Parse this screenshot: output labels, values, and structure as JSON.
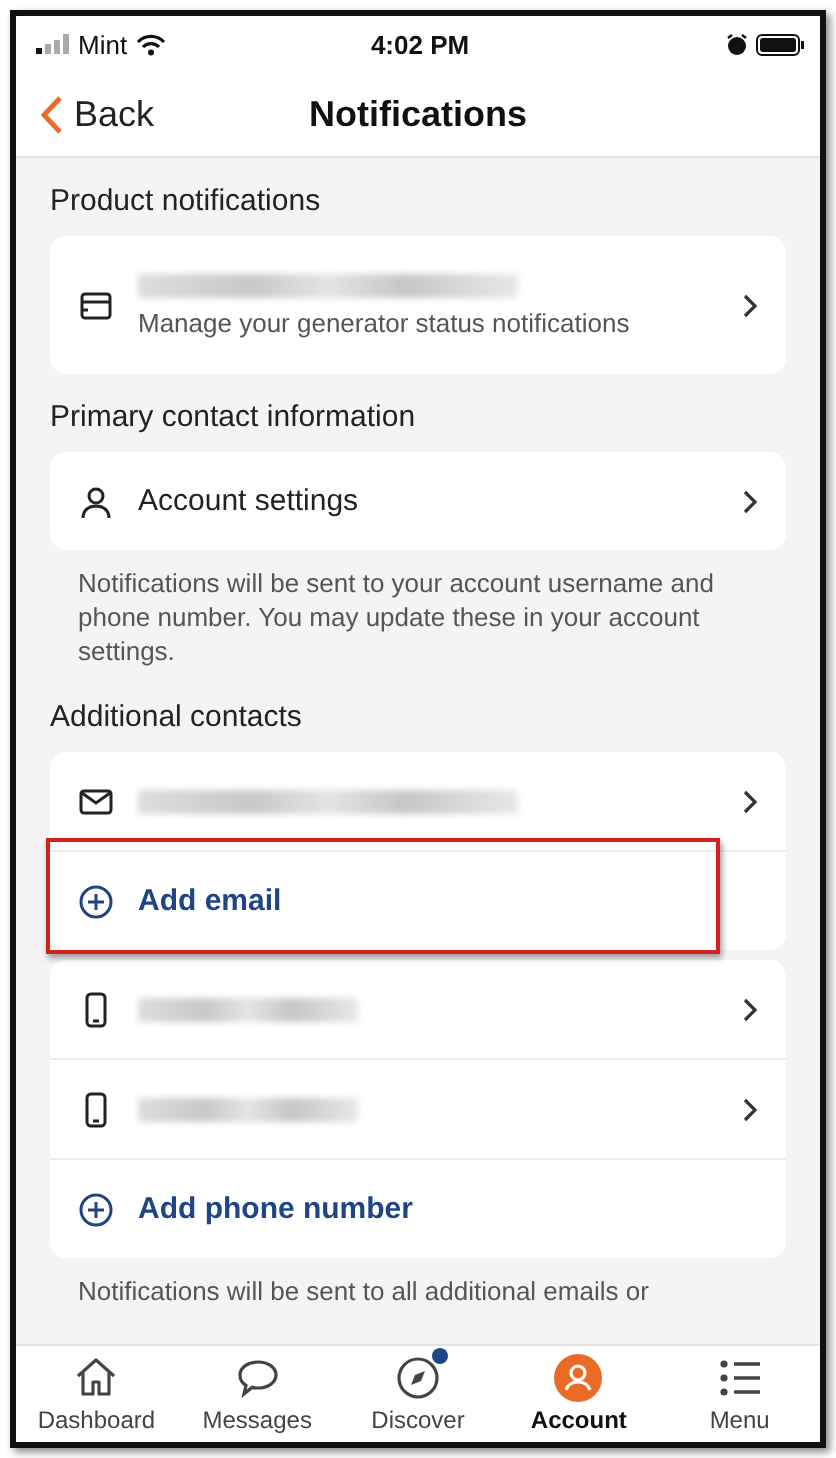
{
  "status_bar": {
    "carrier": "Mint",
    "time": "4:02 PM"
  },
  "nav": {
    "back": "Back",
    "title": "Notifications"
  },
  "sections": [
    {
      "title": "Product notifications",
      "cards": [
        [
          {
            "kind": "product",
            "redacted": true,
            "subtitle": "Manage your generator status notifications"
          }
        ]
      ]
    },
    {
      "title": "Primary contact information",
      "cards": [
        [
          {
            "kind": "account",
            "label": "Account settings"
          }
        ]
      ],
      "note": "Notifications will be sent to your account username and phone number. You may update these in your account settings."
    },
    {
      "title": "Additional contacts",
      "cards": [
        [
          {
            "kind": "email",
            "redacted": true
          },
          {
            "kind": "add",
            "label": "Add email",
            "highlighted": true
          }
        ],
        [
          {
            "kind": "phone",
            "redacted": true
          },
          {
            "kind": "phone",
            "redacted": true
          },
          {
            "kind": "add",
            "label": "Add phone number"
          }
        ]
      ],
      "note": "Notifications will be sent to all additional emails or"
    }
  ],
  "tabs": [
    {
      "label": "Dashboard",
      "kind": "home",
      "selected": false,
      "badge": false
    },
    {
      "label": "Messages",
      "kind": "chat",
      "selected": false,
      "badge": false
    },
    {
      "label": "Discover",
      "kind": "compass",
      "selected": false,
      "badge": true
    },
    {
      "label": "Account",
      "kind": "account",
      "selected": true,
      "badge": false
    },
    {
      "label": "Menu",
      "kind": "menu",
      "selected": false,
      "badge": false
    }
  ]
}
